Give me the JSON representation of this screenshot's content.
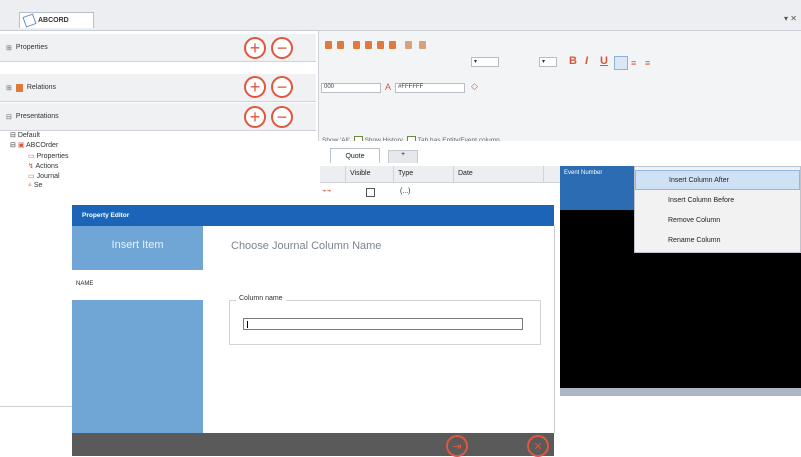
{
  "document_tab": {
    "title": "ABCORD",
    "close_glyph": "▾ ✕"
  },
  "left_pane": {
    "sections": [
      {
        "label": "Properties",
        "expand": "⊞"
      },
      {
        "label": "Relations",
        "expand": "⊞"
      },
      {
        "label": "Presentations",
        "expand": "⊟"
      }
    ],
    "add_glyph": "+",
    "remove_glyph": "−",
    "tree": {
      "default": "Default",
      "abcorder": "ABCOrder",
      "properties": "Properties",
      "actions": "Actions",
      "journal": "Journal",
      "se": "Se"
    }
  },
  "toolbar": {
    "font_size": "000",
    "color_value": "#FFFFFF",
    "bold": "B",
    "italic": "I",
    "underline": "U",
    "options_text": "Show 'All'",
    "show_history": "Show History",
    "tab_entity": "Tab has Entity/Event column"
  },
  "tabs": {
    "quote": "Quote",
    "new_tab": "+"
  },
  "grid": {
    "headers": [
      "Visible",
      "Type",
      "Date"
    ],
    "selected_column": "Event\nNumber"
  },
  "context_menu": {
    "items": [
      "Insert Column After",
      "Insert Column Before",
      "Remove Column",
      "Rename Column"
    ]
  },
  "dialog": {
    "title": "Property Editor",
    "side_header": "Insert Item",
    "side_name": "NAME",
    "heading": "Choose Journal Column Name",
    "group_label": "Column name",
    "field_value": "",
    "next_glyph": "⇥",
    "cancel_glyph": "✕"
  },
  "colors": {
    "accent": "#1b64b8",
    "brand_orange": "#e2553f",
    "sidebar": "#6fa6d6"
  }
}
